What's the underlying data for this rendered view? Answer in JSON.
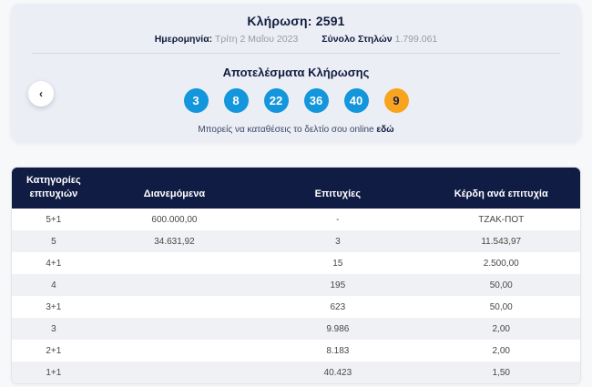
{
  "header": {
    "draw_label": "Κλήρωση:",
    "draw_number": "2591",
    "draw_title": "Κλήρωση: 2591",
    "date_label": "Ημερομηνία:",
    "date_value": "Τρίτη 2 Μαΐου 2023",
    "columns_label": "Σύνολο Στηλών",
    "columns_value": "1.799.061"
  },
  "results": {
    "title": "Αποτελέσματα Κλήρωσης",
    "numbers": [
      "3",
      "8",
      "22",
      "36",
      "40"
    ],
    "bonus_number": "9",
    "deposit_text": "Μπορείς να καταθέσεις το δελτίο σου online",
    "deposit_cta": "εδώ",
    "prev_arrow": "‹"
  },
  "table": {
    "headers": [
      "Κατηγορίες επιτυχιών",
      "Διανεμόμενα",
      "Επιτυχίες",
      "Κέρδη ανά επιτυχία"
    ],
    "rows": [
      {
        "category": "5+1",
        "distributed": "600.000,00",
        "winners": "-",
        "prize": "ΤΖΑΚ-ΠΟΤ"
      },
      {
        "category": "5",
        "distributed": "34.631,92",
        "winners": "3",
        "prize": "11.543,97"
      },
      {
        "category": "4+1",
        "distributed": "",
        "winners": "15",
        "prize": "2.500,00"
      },
      {
        "category": "4",
        "distributed": "",
        "winners": "195",
        "prize": "50,00"
      },
      {
        "category": "3+1",
        "distributed": "",
        "winners": "623",
        "prize": "50,00"
      },
      {
        "category": "3",
        "distributed": "",
        "winners": "9.986",
        "prize": "2,00"
      },
      {
        "category": "2+1",
        "distributed": "",
        "winners": "8.183",
        "prize": "2,00"
      },
      {
        "category": "1+1",
        "distributed": "",
        "winners": "40.423",
        "prize": "1,50"
      }
    ]
  },
  "colors": {
    "navy": "#101c44",
    "number_blue": "#1496dc",
    "bonus_orange": "#f9a41f",
    "card_background": "#ebeef5",
    "alt_row": "#f0f1f4"
  }
}
